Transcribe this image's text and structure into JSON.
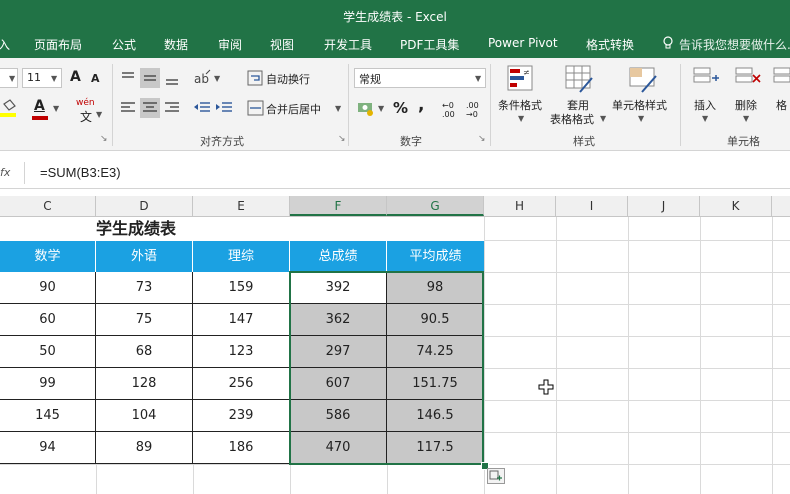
{
  "window": {
    "title": "学生成绩表 - Excel"
  },
  "ribbon_tabs": [
    "入",
    "页面布局",
    "公式",
    "数据",
    "审阅",
    "视图",
    "开发工具",
    "PDF工具集",
    "Power Pivot",
    "格式转换"
  ],
  "tell_me": "告诉我您想要做什么...",
  "ribbon": {
    "font_size": "11",
    "font_grow": "A",
    "font_shrink": "A",
    "font_color_label": "A",
    "wen_label": "wén",
    "wrap_text": "自动换行",
    "merge_center": "合并后居中",
    "align_group": "对齐方式",
    "number_format": "常规",
    "percent": "%",
    "comma": ",",
    "dec_inc": "←0 .00",
    "dec_dec": ".00 →0",
    "number_group": "数字",
    "cond_format": "条件格式",
    "table_format_1": "套用",
    "table_format_2": "表格格式",
    "cell_styles": "单元格样式",
    "styles_group": "样式",
    "insert": "插入",
    "delete": "删除",
    "format_partial": "格",
    "cells_group": "单元格"
  },
  "formula_bar": {
    "fx": "fx",
    "formula": "=SUM(B3:E3)"
  },
  "columns": [
    "C",
    "D",
    "E",
    "F",
    "G",
    "H",
    "I",
    "J",
    "K"
  ],
  "sheet": {
    "title": "学生成绩表",
    "headers": [
      "数学",
      "外语",
      "理综",
      "总成绩",
      "平均成绩"
    ],
    "rows": [
      [
        "90",
        "73",
        "159",
        "392",
        "98"
      ],
      [
        "60",
        "75",
        "147",
        "362",
        "90.5"
      ],
      [
        "50",
        "68",
        "123",
        "297",
        "74.25"
      ],
      [
        "99",
        "128",
        "256",
        "607",
        "151.75"
      ],
      [
        "145",
        "104",
        "239",
        "586",
        "146.5"
      ],
      [
        "94",
        "89",
        "186",
        "470",
        "117.5"
      ]
    ]
  },
  "colors": {
    "excel_green": "#217346",
    "header_blue": "#1ba1e2",
    "selection_gray": "#c8c8c8"
  }
}
